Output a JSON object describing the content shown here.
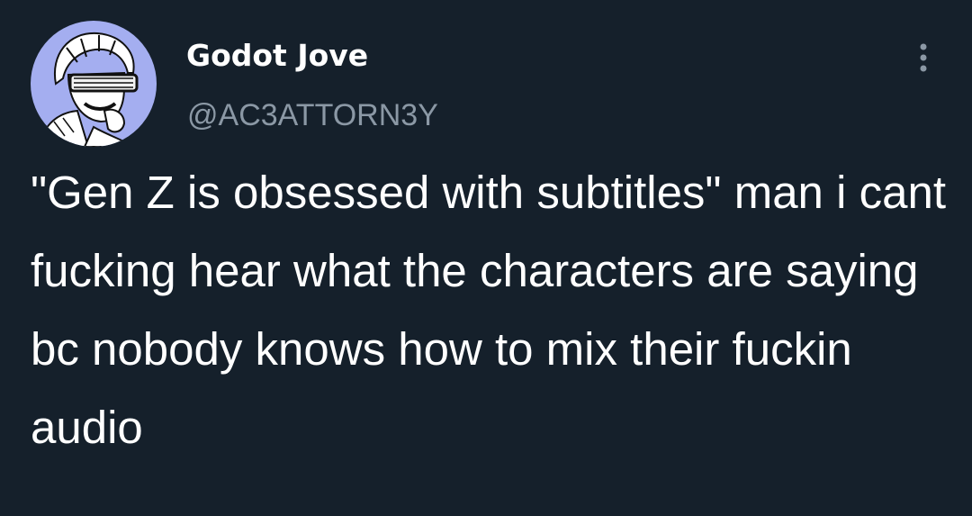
{
  "author": {
    "display_name": "Godot Jove",
    "handle": "@AC3ATTORN3Y",
    "avatar_icon": "profile-avatar"
  },
  "menu": {
    "icon": "more-options-icon"
  },
  "tweet": {
    "text": "\"Gen Z is obsessed with subtitles\" man i cant fucking hear what the characters are saying bc nobody knows how to mix their fuckin audio"
  },
  "colors": {
    "background": "#15202b",
    "text_primary": "#ffffff",
    "text_secondary": "#8b98a5",
    "avatar_background": "#a4aef0"
  }
}
